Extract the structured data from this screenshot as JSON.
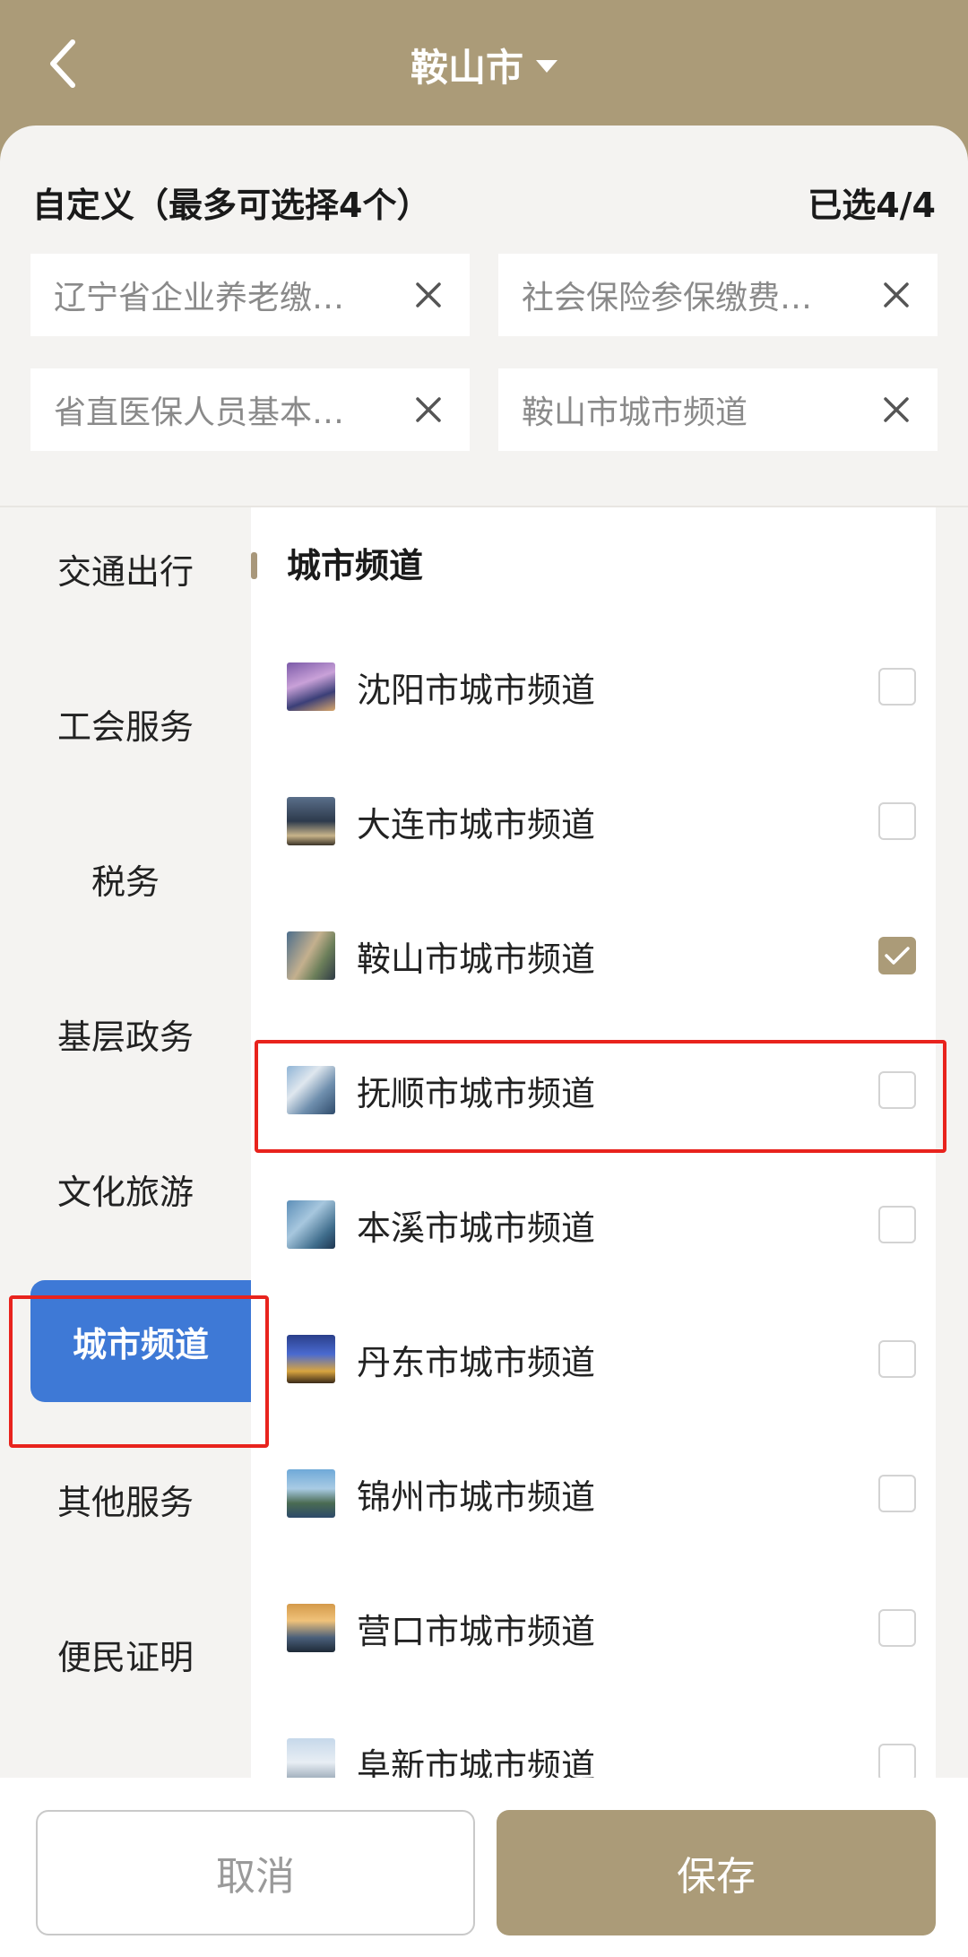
{
  "header": {
    "title": "鞍山市",
    "back_icon": "chevron-left-icon",
    "dropdown_icon": "caret-down-icon"
  },
  "custom": {
    "title": "自定义（最多可选择4个）",
    "count": "已选4/4",
    "chips": [
      {
        "label": "辽宁省企业养老缴…"
      },
      {
        "label": "社会保险参保缴费…"
      },
      {
        "label": "省直医保人员基本…"
      },
      {
        "label": "鞍山市城市频道"
      }
    ]
  },
  "sidebar": {
    "items": [
      {
        "label": "交通出行"
      },
      {
        "label": "工会服务"
      },
      {
        "label": "税务"
      },
      {
        "label": "基层政务"
      },
      {
        "label": "文化旅游"
      },
      {
        "label": "城市频道",
        "active": true
      },
      {
        "label": "其他服务"
      },
      {
        "label": "便民证明"
      }
    ]
  },
  "content": {
    "section_title": "城市频道",
    "items": [
      {
        "label": "沈阳市城市频道",
        "checked": false
      },
      {
        "label": "大连市城市频道",
        "checked": false
      },
      {
        "label": "鞍山市城市频道",
        "checked": true
      },
      {
        "label": "抚顺市城市频道",
        "checked": false
      },
      {
        "label": "本溪市城市频道",
        "checked": false
      },
      {
        "label": "丹东市城市频道",
        "checked": false
      },
      {
        "label": "锦州市城市频道",
        "checked": false
      },
      {
        "label": "营口市城市频道",
        "checked": false
      },
      {
        "label": "阜新市城市频道",
        "checked": false
      }
    ]
  },
  "footer": {
    "cancel_label": "取消",
    "save_label": "保存"
  },
  "colors": {
    "brand": "#ab9b78",
    "active_blue": "#3e79d6",
    "highlight_red": "#e8231d"
  }
}
